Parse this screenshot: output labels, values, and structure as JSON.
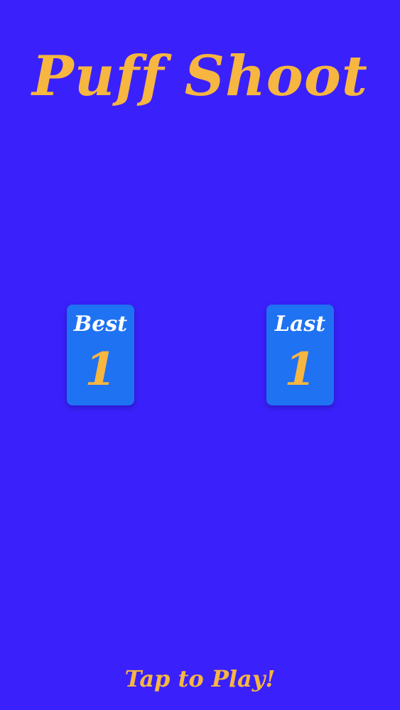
{
  "app": {
    "title": "Puff Shoot"
  },
  "scores": {
    "best": {
      "label": "Best",
      "value": "1"
    },
    "last": {
      "label": "Last",
      "value": "1"
    }
  },
  "action": {
    "tap_label": "Tap to Play!"
  },
  "colors": {
    "background": "#3a21fb",
    "card": "#1f72f2",
    "accent": "#f6b63f",
    "label": "#ffffff"
  }
}
